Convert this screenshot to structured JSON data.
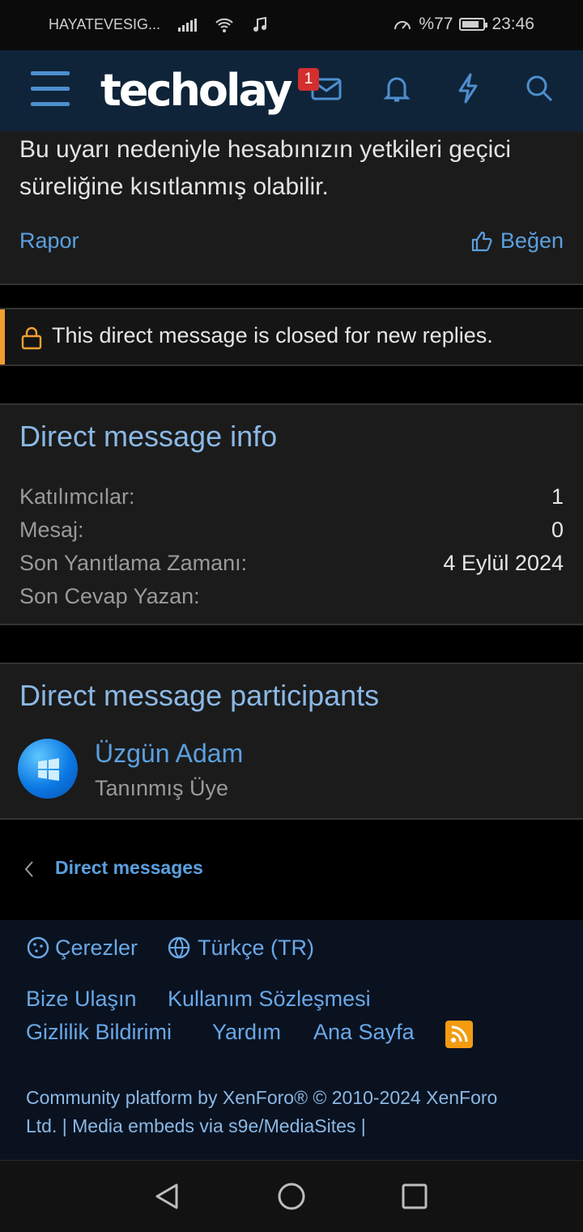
{
  "status_bar": {
    "carrier": "HAYATEVESIG...",
    "battery": "%77",
    "time": "23:46"
  },
  "header": {
    "logo": "techolay",
    "notification_count": "1"
  },
  "post": {
    "text": "Bu uyarı nedeniyle hesabınızın yetkileri geçici süreliğine kısıtlanmış olabilir.",
    "report_label": "Rapor",
    "like_label": "Beğen"
  },
  "closed_notice": "This direct message is closed for new replies.",
  "info": {
    "title": "Direct message info",
    "rows": [
      {
        "label": "Katılımcılar:",
        "value": "1"
      },
      {
        "label": "Mesaj:",
        "value": "0"
      },
      {
        "label": "Son Yanıtlama Zamanı:",
        "value": "4 Eylül 2024"
      },
      {
        "label": "Son Cevap Yazan:",
        "value": ""
      }
    ]
  },
  "participants": {
    "title": "Direct message participants",
    "user": {
      "name": "Üzgün Adam",
      "role": "Tanınmış Üye"
    }
  },
  "breadcrumb": "Direct messages",
  "footer": {
    "cookies": "Çerezler",
    "language": "Türkçe (TR)",
    "contact": "Bize Ulaşın",
    "terms": "Kullanım Sözleşmesi",
    "privacy": "Gizlilik Bildirimi",
    "help": "Yardım",
    "home": "Ana Sayfa",
    "copyright_line1": "Community platform by XenForo® © 2010-2024 XenForo",
    "copyright_line2": "Ltd. | Media embeds via s9e/MediaSites |"
  },
  "colors": {
    "accent": "#5aa0e0",
    "header_bg": "#0f2438",
    "warning_bar": "#f0a02f"
  }
}
